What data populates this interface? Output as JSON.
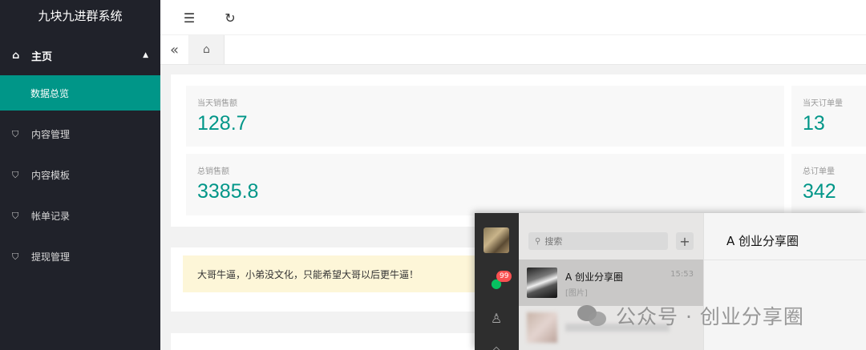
{
  "app": {
    "title": "九块九进群系统"
  },
  "sidebar": {
    "parent": {
      "label": "主页"
    },
    "active_child": {
      "label": "数据总览"
    },
    "items": [
      {
        "label": "内容管理"
      },
      {
        "label": "内容模板"
      },
      {
        "label": "帐单记录"
      },
      {
        "label": "提现管理"
      }
    ]
  },
  "stats": {
    "today_sales_label": "当天销售额",
    "today_sales_value": "128.7",
    "today_orders_label": "当天订单量",
    "today_orders_value": "13",
    "total_sales_label": "总销售额",
    "total_sales_value": "3385.8",
    "total_orders_label": "总订单量",
    "total_orders_value": "342"
  },
  "notice": {
    "text": "大哥牛逼，小弟没文化，只能希望大哥以后更牛逼！"
  },
  "chat": {
    "search_placeholder": "搜索",
    "unread_badge": "99",
    "active_conversation": {
      "name": "A 创业分享圈",
      "time": "15:53",
      "preview": "[图片]"
    },
    "window_title": "A 创业分享圈"
  },
  "watermark": {
    "text": "公众号 · 创业分享圈"
  },
  "colors": {
    "accent": "#009688",
    "sidebar_bg": "#20222a",
    "notice_bg": "#fdf6d8"
  }
}
